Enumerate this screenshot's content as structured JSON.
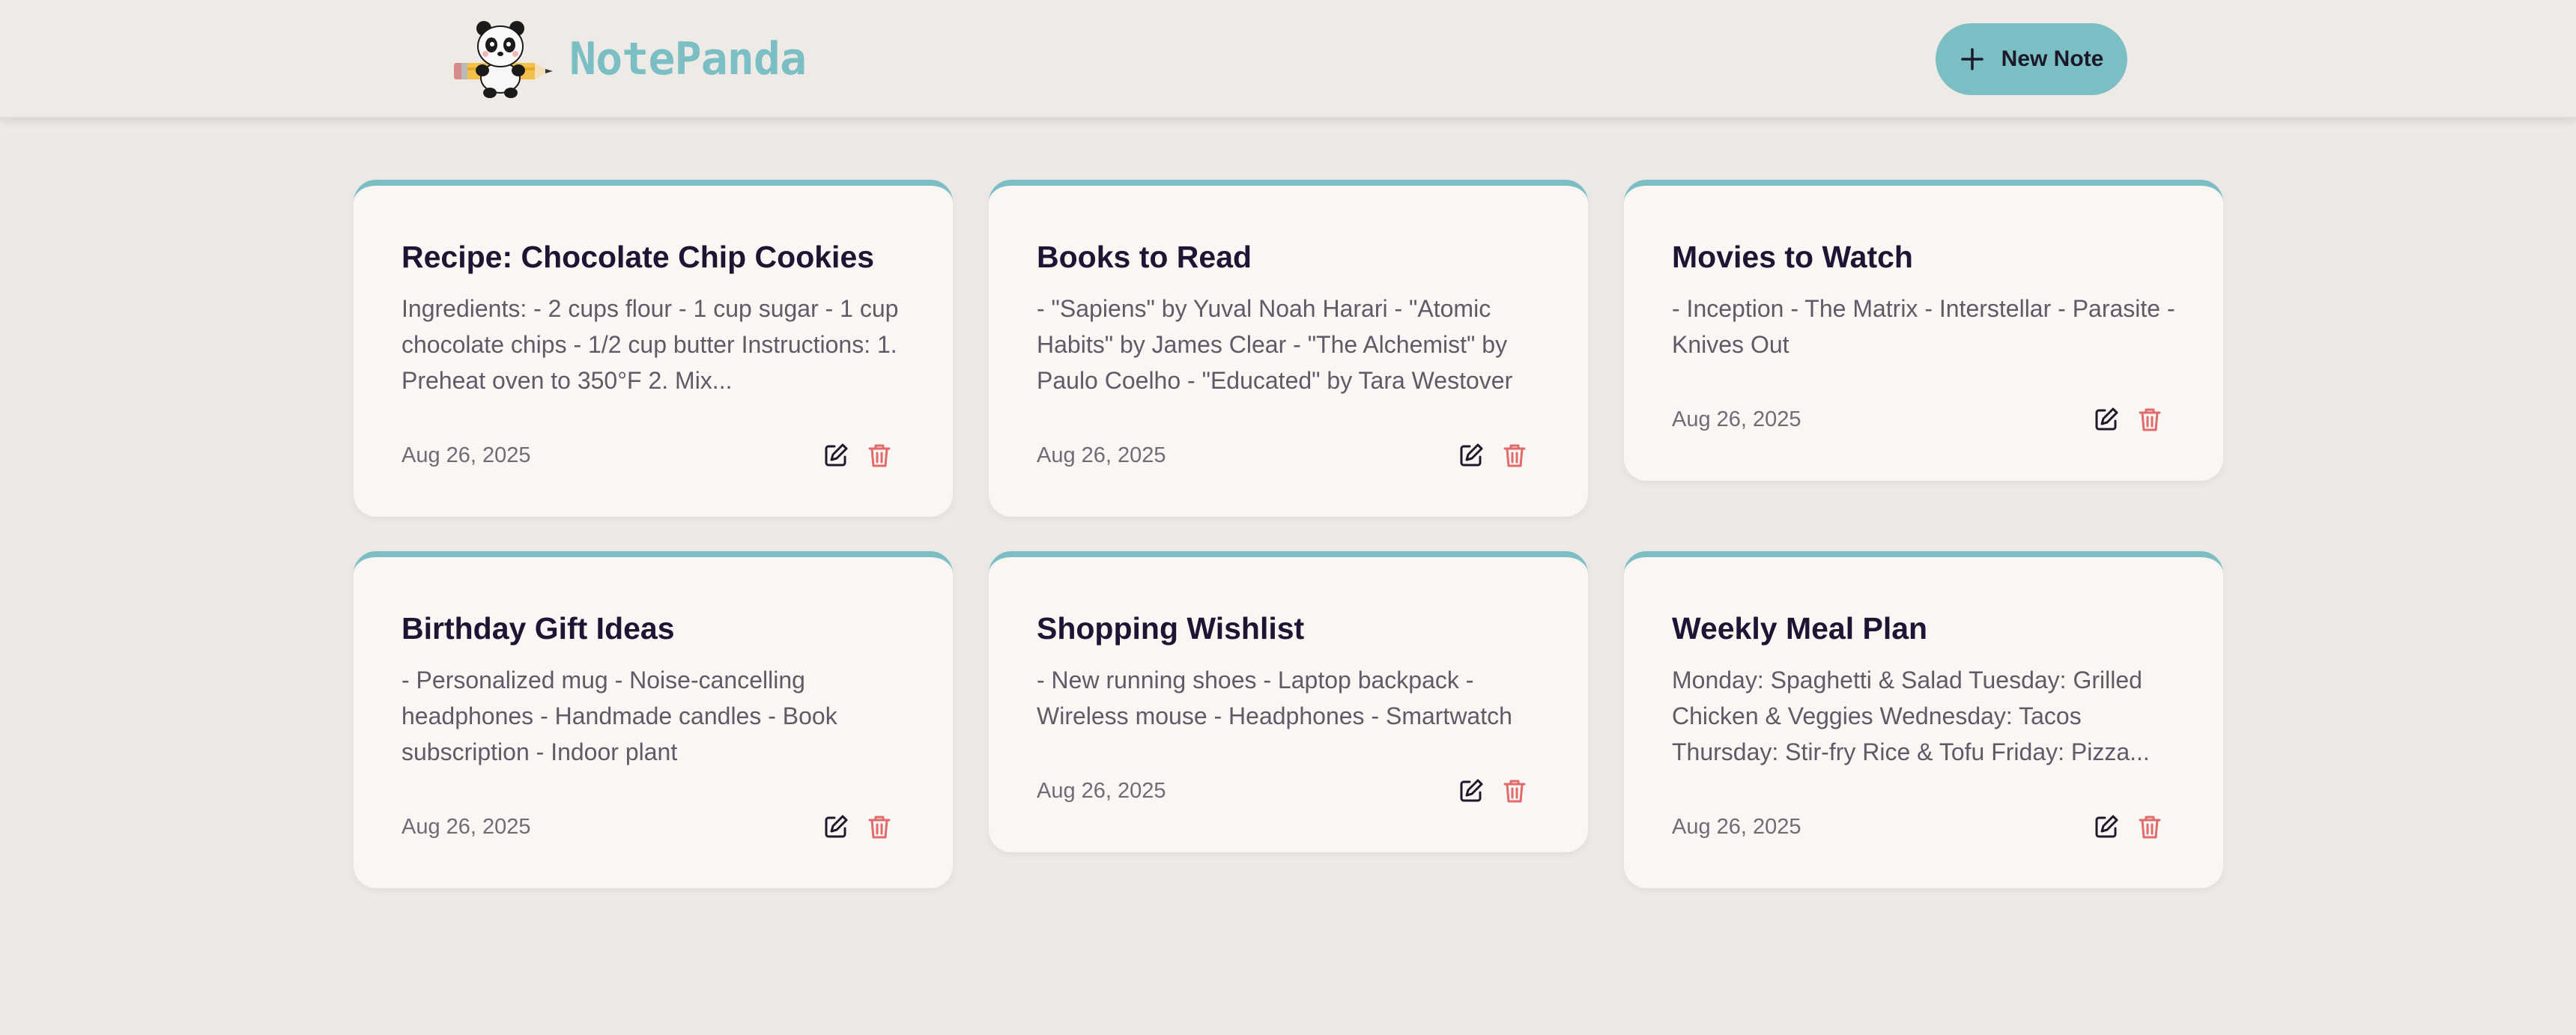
{
  "app": {
    "name": "NotePanda",
    "new_note_label": "New Note"
  },
  "colors": {
    "accent": "#7bbfc5",
    "background": "#ede9e5",
    "card": "#faf6f3",
    "title": "#1c1533",
    "delete": "#e26a6a"
  },
  "icons": {
    "logo": "panda-with-pencil-logo",
    "new_note": "plus-icon",
    "edit": "edit-icon",
    "delete": "trash-icon"
  },
  "notes": [
    {
      "title": "Recipe: Chocolate Chip Cookies",
      "content": "Ingredients: - 2 cups flour - 1 cup sugar - 1 cup chocolate chips - 1/2 cup butter Instructions: 1. Preheat oven to 350°F 2. Mix...",
      "date": "Aug 26, 2025"
    },
    {
      "title": "Books to Read",
      "content": "- \"Sapiens\" by Yuval Noah Harari - \"Atomic Habits\" by James Clear - \"The Alchemist\" by Paulo Coelho - \"Educated\" by Tara Westover",
      "date": "Aug 26, 2025"
    },
    {
      "title": "Movies to Watch",
      "content": "- Inception - The Matrix - Interstellar - Parasite - Knives Out",
      "date": "Aug 26, 2025"
    },
    {
      "title": "Birthday Gift Ideas",
      "content": "- Personalized mug - Noise-cancelling headphones - Handmade candles - Book subscription - Indoor plant",
      "date": "Aug 26, 2025"
    },
    {
      "title": "Shopping Wishlist",
      "content": "- New running shoes - Laptop backpack - Wireless mouse - Headphones - Smartwatch",
      "date": "Aug 26, 2025"
    },
    {
      "title": "Weekly Meal Plan",
      "content": "Monday: Spaghetti & Salad Tuesday: Grilled Chicken & Veggies Wednesday: Tacos Thursday: Stir-fry Rice & Tofu Friday: Pizza...",
      "date": "Aug 26, 2025"
    }
  ]
}
